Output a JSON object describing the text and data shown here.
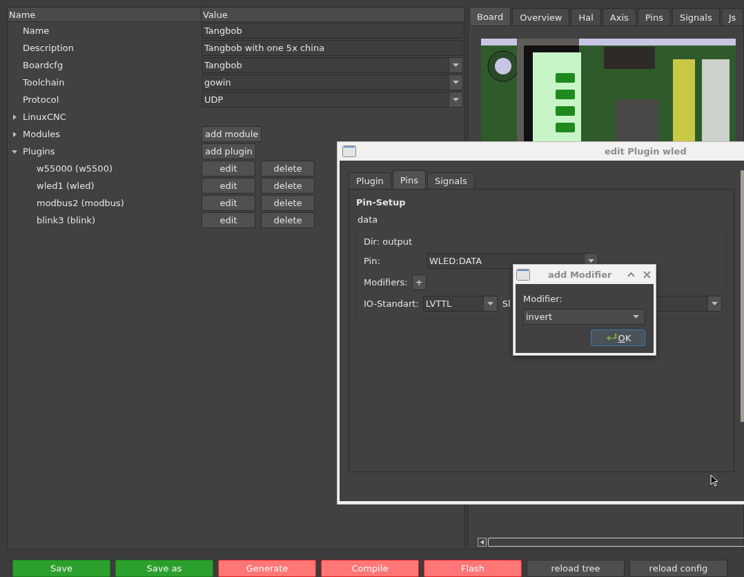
{
  "tree": {
    "columns": [
      "Name",
      "Value"
    ],
    "rows": [
      {
        "kind": "field",
        "label": "Name",
        "value": "Tangbob"
      },
      {
        "kind": "field",
        "label": "Description",
        "value": "Tangbob with one 5x china"
      },
      {
        "kind": "combo",
        "label": "Boardcfg",
        "value": "Tangbob"
      },
      {
        "kind": "combo",
        "label": "Toolchain",
        "value": "gowin"
      },
      {
        "kind": "combo",
        "label": "Protocol",
        "value": "UDP"
      },
      {
        "kind": "group",
        "label": "LinuxCNC",
        "expanded": false
      },
      {
        "kind": "group",
        "label": "Modules",
        "expanded": false,
        "button": "add module"
      },
      {
        "kind": "group",
        "label": "Plugins",
        "expanded": true,
        "button": "add plugin",
        "children": [
          {
            "label": "w55000 (w5500)",
            "buttons": [
              "edit",
              "delete"
            ]
          },
          {
            "label": "wled1 (wled)",
            "buttons": [
              "edit",
              "delete"
            ]
          },
          {
            "label": "modbus2 (modbus)",
            "buttons": [
              "edit",
              "delete"
            ]
          },
          {
            "label": "blink3 (blink)",
            "buttons": [
              "edit",
              "delete"
            ]
          }
        ]
      }
    ]
  },
  "board_tabs": [
    {
      "label": "Board",
      "selected": true
    },
    {
      "label": "Overview",
      "selected": false
    },
    {
      "label": "Hal",
      "selected": false
    },
    {
      "label": "Axis",
      "selected": false
    },
    {
      "label": "Pins",
      "selected": false
    },
    {
      "label": "Signals",
      "selected": false
    },
    {
      "label": "Js",
      "selected": false
    }
  ],
  "edit_dialog": {
    "title": "edit Plugin wled",
    "tabs": [
      {
        "label": "Plugin",
        "selected": false
      },
      {
        "label": "Pins",
        "selected": true
      },
      {
        "label": "Signals",
        "selected": false
      }
    ],
    "heading": "Pin-Setup",
    "pin_name": "data",
    "direction": "Dir: output",
    "pin_label": "Pin:",
    "pin_value": "WLED:DATA",
    "modifiers_label": "Modifiers:",
    "add_button": "+",
    "io_label": "IO-Standart:",
    "io_value": "LVTTL",
    "slew_label": "Sl"
  },
  "modifier_dialog": {
    "title": "add Modifier",
    "field_label": "Modifier:",
    "value": "invert",
    "ok": "OK"
  },
  "actions": [
    {
      "label": "Save",
      "kind": "success"
    },
    {
      "label": "Save as",
      "kind": "success"
    },
    {
      "label": "Generate",
      "kind": "danger"
    },
    {
      "label": "Compile",
      "kind": "danger"
    },
    {
      "label": "Flash",
      "kind": "danger"
    },
    {
      "label": "reload tree",
      "kind": "normal"
    },
    {
      "label": "reload config",
      "kind": "normal"
    }
  ]
}
